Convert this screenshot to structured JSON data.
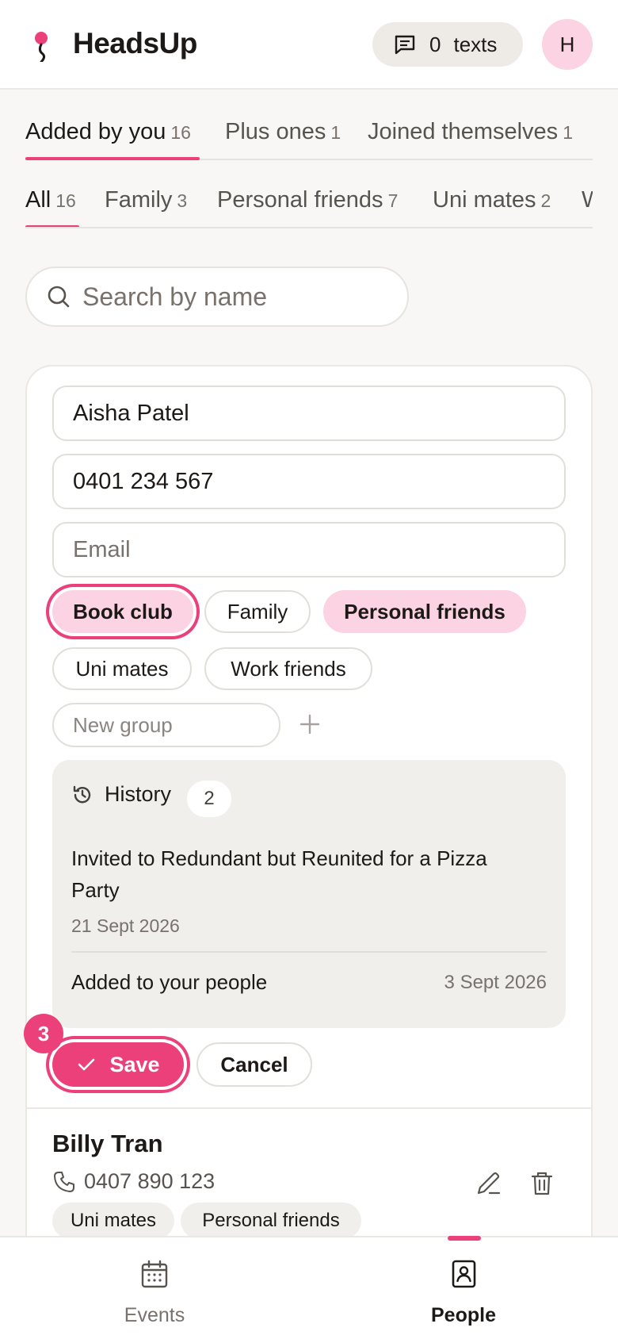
{
  "header": {
    "app_name": "HeadsUp",
    "texts_count": "0",
    "texts_label": "texts",
    "avatar_initial": "H"
  },
  "source_tabs": [
    {
      "label": "Added by you",
      "count": "16",
      "active": true
    },
    {
      "label": "Plus ones",
      "count": "1",
      "active": false
    },
    {
      "label": "Joined themselves",
      "count": "1",
      "active": false
    }
  ],
  "group_tabs": [
    {
      "label": "All",
      "count": "16",
      "active": true
    },
    {
      "label": "Family",
      "count": "3",
      "active": false
    },
    {
      "label": "Personal friends",
      "count": "7",
      "active": false
    },
    {
      "label": "Uni mates",
      "count": "2",
      "active": false
    },
    {
      "label": "W",
      "count": "",
      "active": false
    }
  ],
  "search": {
    "placeholder": "Search by name",
    "value": ""
  },
  "edit_form": {
    "name_value": "Aisha Patel",
    "phone_value": "0401 234 567",
    "email_placeholder": "Email",
    "email_value": "",
    "groups": [
      {
        "label": "Book club",
        "selected": true,
        "focused": true
      },
      {
        "label": "Family",
        "selected": false
      },
      {
        "label": "Personal friends",
        "selected": true
      },
      {
        "label": "Uni mates",
        "selected": false
      },
      {
        "label": "Work friends",
        "selected": false
      }
    ],
    "new_group_placeholder": "New group",
    "history": {
      "title": "History",
      "count": "2",
      "entries": [
        {
          "text": "Invited to Redundant but Reunited for a Pizza Party",
          "date": "21 Sept 2026"
        },
        {
          "text": "Added to your people",
          "date": "3 Sept 2026"
        }
      ]
    },
    "save_label": "Save",
    "cancel_label": "Cancel",
    "step_badge": "3"
  },
  "people": [
    {
      "name": "Billy Tran",
      "phone": "0407 890 123",
      "tags": [
        "Uni mates",
        "Personal friends"
      ]
    }
  ],
  "bottom_nav": [
    {
      "label": "Events",
      "icon": "calendar-icon",
      "active": false
    },
    {
      "label": "People",
      "icon": "contact-book-icon",
      "active": true
    }
  ],
  "colors": {
    "accent": "#ec407a",
    "accent_soft": "#fcd3e3",
    "background": "#f8f7f5"
  }
}
